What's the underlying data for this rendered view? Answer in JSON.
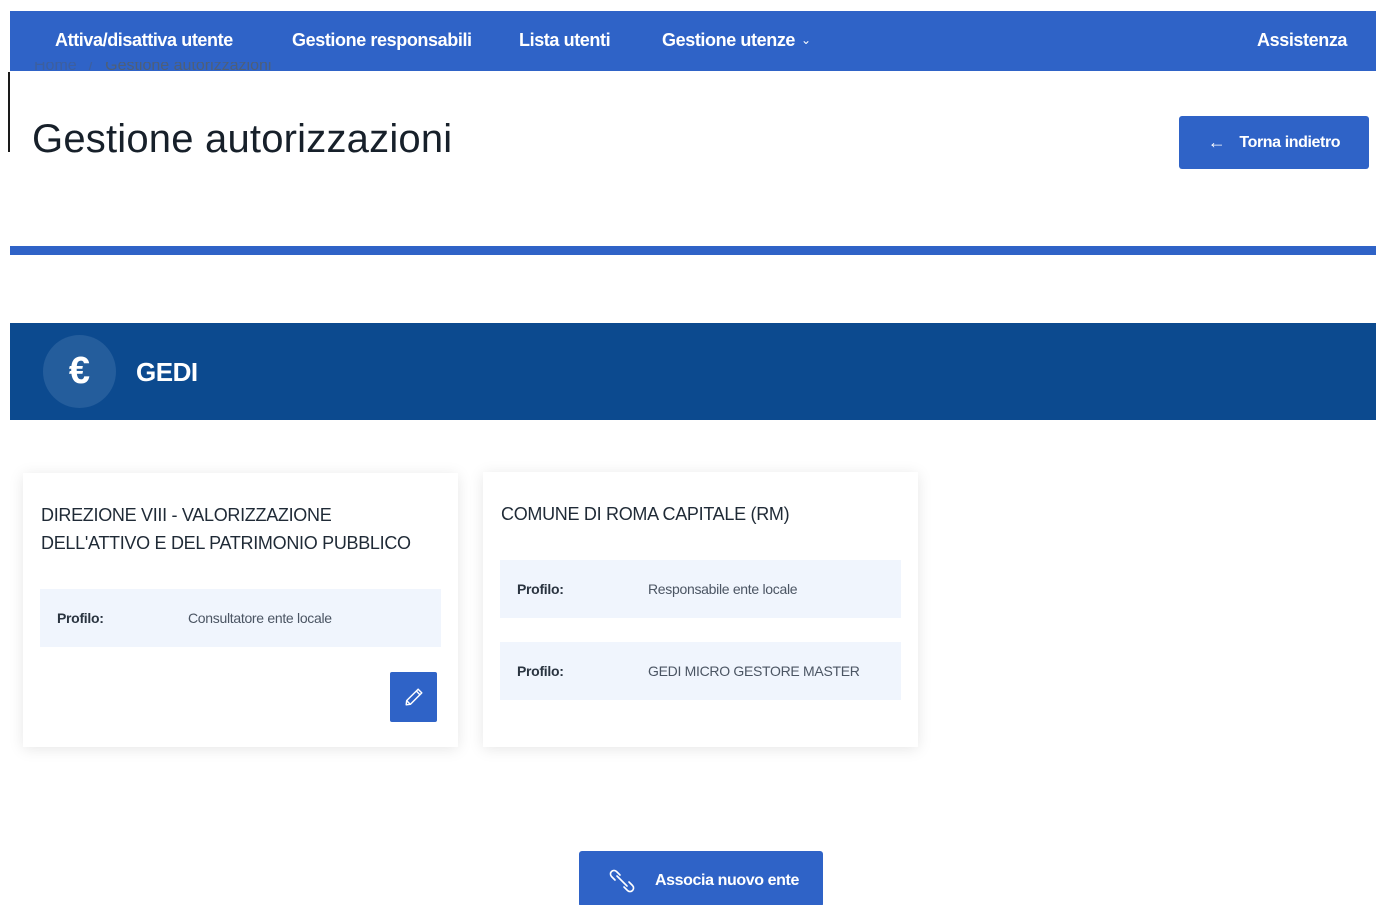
{
  "nav": {
    "items": [
      {
        "label": "Attiva/disattiva utente"
      },
      {
        "label": "Gestione responsabili"
      },
      {
        "label": "Lista utenti"
      },
      {
        "label": "Gestione utenze",
        "dropdown": true
      }
    ],
    "assistance": "Assistenza"
  },
  "breadcrumb": {
    "home": "Home",
    "separator": "/",
    "current": "Gestione autorizzazioni"
  },
  "page": {
    "title": "Gestione autorizzazioni",
    "back_label": "Torna indietro"
  },
  "service": {
    "icon": "euro-icon",
    "name": "GEDI"
  },
  "cards": [
    {
      "title": "DIREZIONE VIII - VALORIZZAZIONE DELL'ATTIVO E DEL PATRIMONIO PUBBLICO",
      "profiles": [
        {
          "label": "Profilo:",
          "value": "Consultatore ente locale"
        }
      ]
    },
    {
      "title": "COMUNE DI ROMA CAPITALE (RM)",
      "profiles": [
        {
          "label": "Profilo:",
          "value": "Responsabile ente locale"
        },
        {
          "label": "Profilo:",
          "value": "GEDI MICRO GESTORE MASTER"
        }
      ]
    }
  ],
  "actions": {
    "associate_label": "Associa nuovo ente"
  },
  "colors": {
    "primary": "#2f63c7",
    "banner": "#0c4a8f",
    "row_bg": "#f0f5fd"
  }
}
